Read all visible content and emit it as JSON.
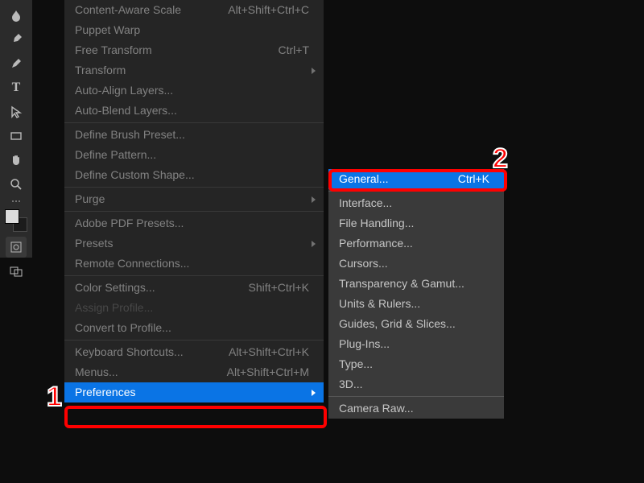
{
  "tools": [
    "smudge-tool-icon",
    "eyedropper-tool-icon",
    "brush-tool-icon",
    "type-tool-icon",
    "direct-select-tool-icon",
    "rectangle-tool-icon",
    "hand-tool-icon",
    "zoom-tool-icon",
    "grip-icon",
    "swatches",
    "quickmask-icon",
    "screenmode-icon"
  ],
  "edit_menu": [
    {
      "label": "Content-Aware Scale",
      "kb": "Alt+Shift+Ctrl+C"
    },
    {
      "label": "Puppet Warp"
    },
    {
      "label": "Free Transform",
      "kb": "Ctrl+T"
    },
    {
      "label": "Transform",
      "submenu": true
    },
    {
      "label": "Auto-Align Layers..."
    },
    {
      "label": "Auto-Blend Layers..."
    },
    {
      "sep": true
    },
    {
      "label": "Define Brush Preset..."
    },
    {
      "label": "Define Pattern..."
    },
    {
      "label": "Define Custom Shape..."
    },
    {
      "sep": true
    },
    {
      "label": "Purge",
      "submenu": true
    },
    {
      "sep": true
    },
    {
      "label": "Adobe PDF Presets..."
    },
    {
      "label": "Presets",
      "submenu": true
    },
    {
      "label": "Remote Connections..."
    },
    {
      "sep": true
    },
    {
      "label": "Color Settings...",
      "kb": "Shift+Ctrl+K"
    },
    {
      "label": "Assign Profile...",
      "disabled": true
    },
    {
      "label": "Convert to Profile..."
    },
    {
      "sep": true
    },
    {
      "label": "Keyboard Shortcuts...",
      "kb": "Alt+Shift+Ctrl+K"
    },
    {
      "label": "Menus...",
      "kb": "Alt+Shift+Ctrl+M"
    },
    {
      "label": "Preferences",
      "submenu": true,
      "highlight": true
    }
  ],
  "pref_submenu": [
    {
      "label": "General...",
      "kb": "Ctrl+K",
      "highlight": true
    },
    {
      "sep": true
    },
    {
      "label": "Interface..."
    },
    {
      "label": "File Handling..."
    },
    {
      "label": "Performance..."
    },
    {
      "label": "Cursors..."
    },
    {
      "label": "Transparency & Gamut..."
    },
    {
      "label": "Units & Rulers..."
    },
    {
      "label": "Guides, Grid & Slices..."
    },
    {
      "label": "Plug-Ins..."
    },
    {
      "label": "Type..."
    },
    {
      "label": "3D..."
    },
    {
      "sep": true
    },
    {
      "label": "Camera Raw..."
    }
  ],
  "callouts": {
    "one": "1",
    "two": "2"
  }
}
